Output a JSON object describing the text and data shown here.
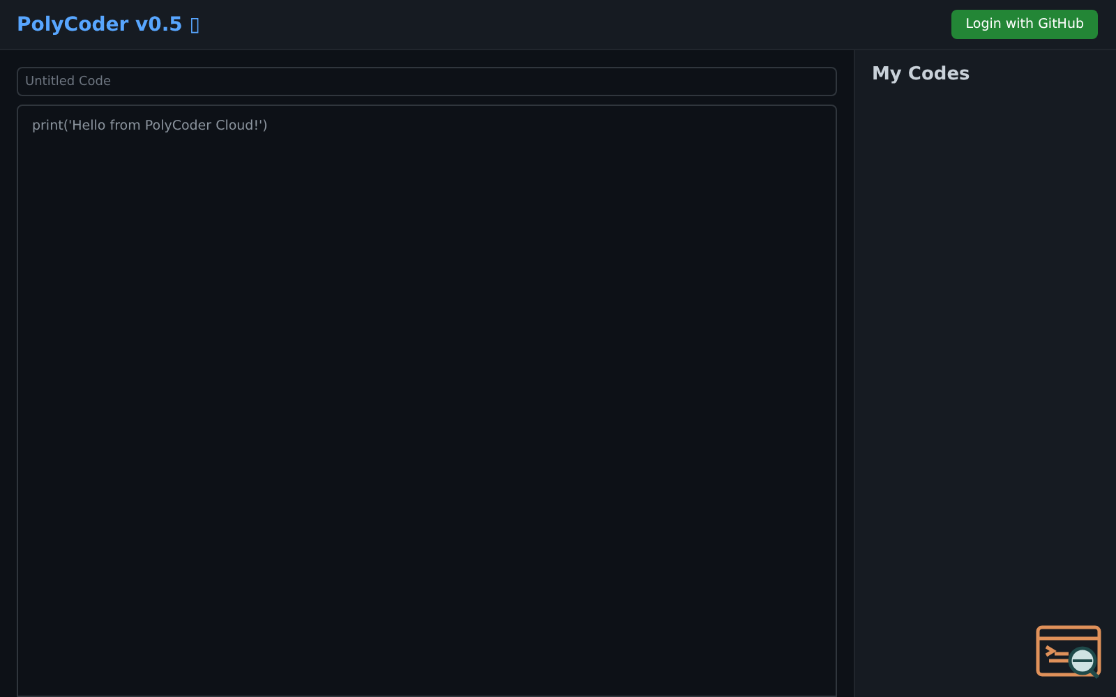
{
  "header": {
    "title": "PolyCoder v0.5 ▯",
    "login_button": "Login with GitHub"
  },
  "editor": {
    "title_placeholder": "Untitled Code",
    "code": "print('Hello from PolyCoder Cloud!')"
  },
  "sidebar": {
    "heading": "My Codes"
  }
}
